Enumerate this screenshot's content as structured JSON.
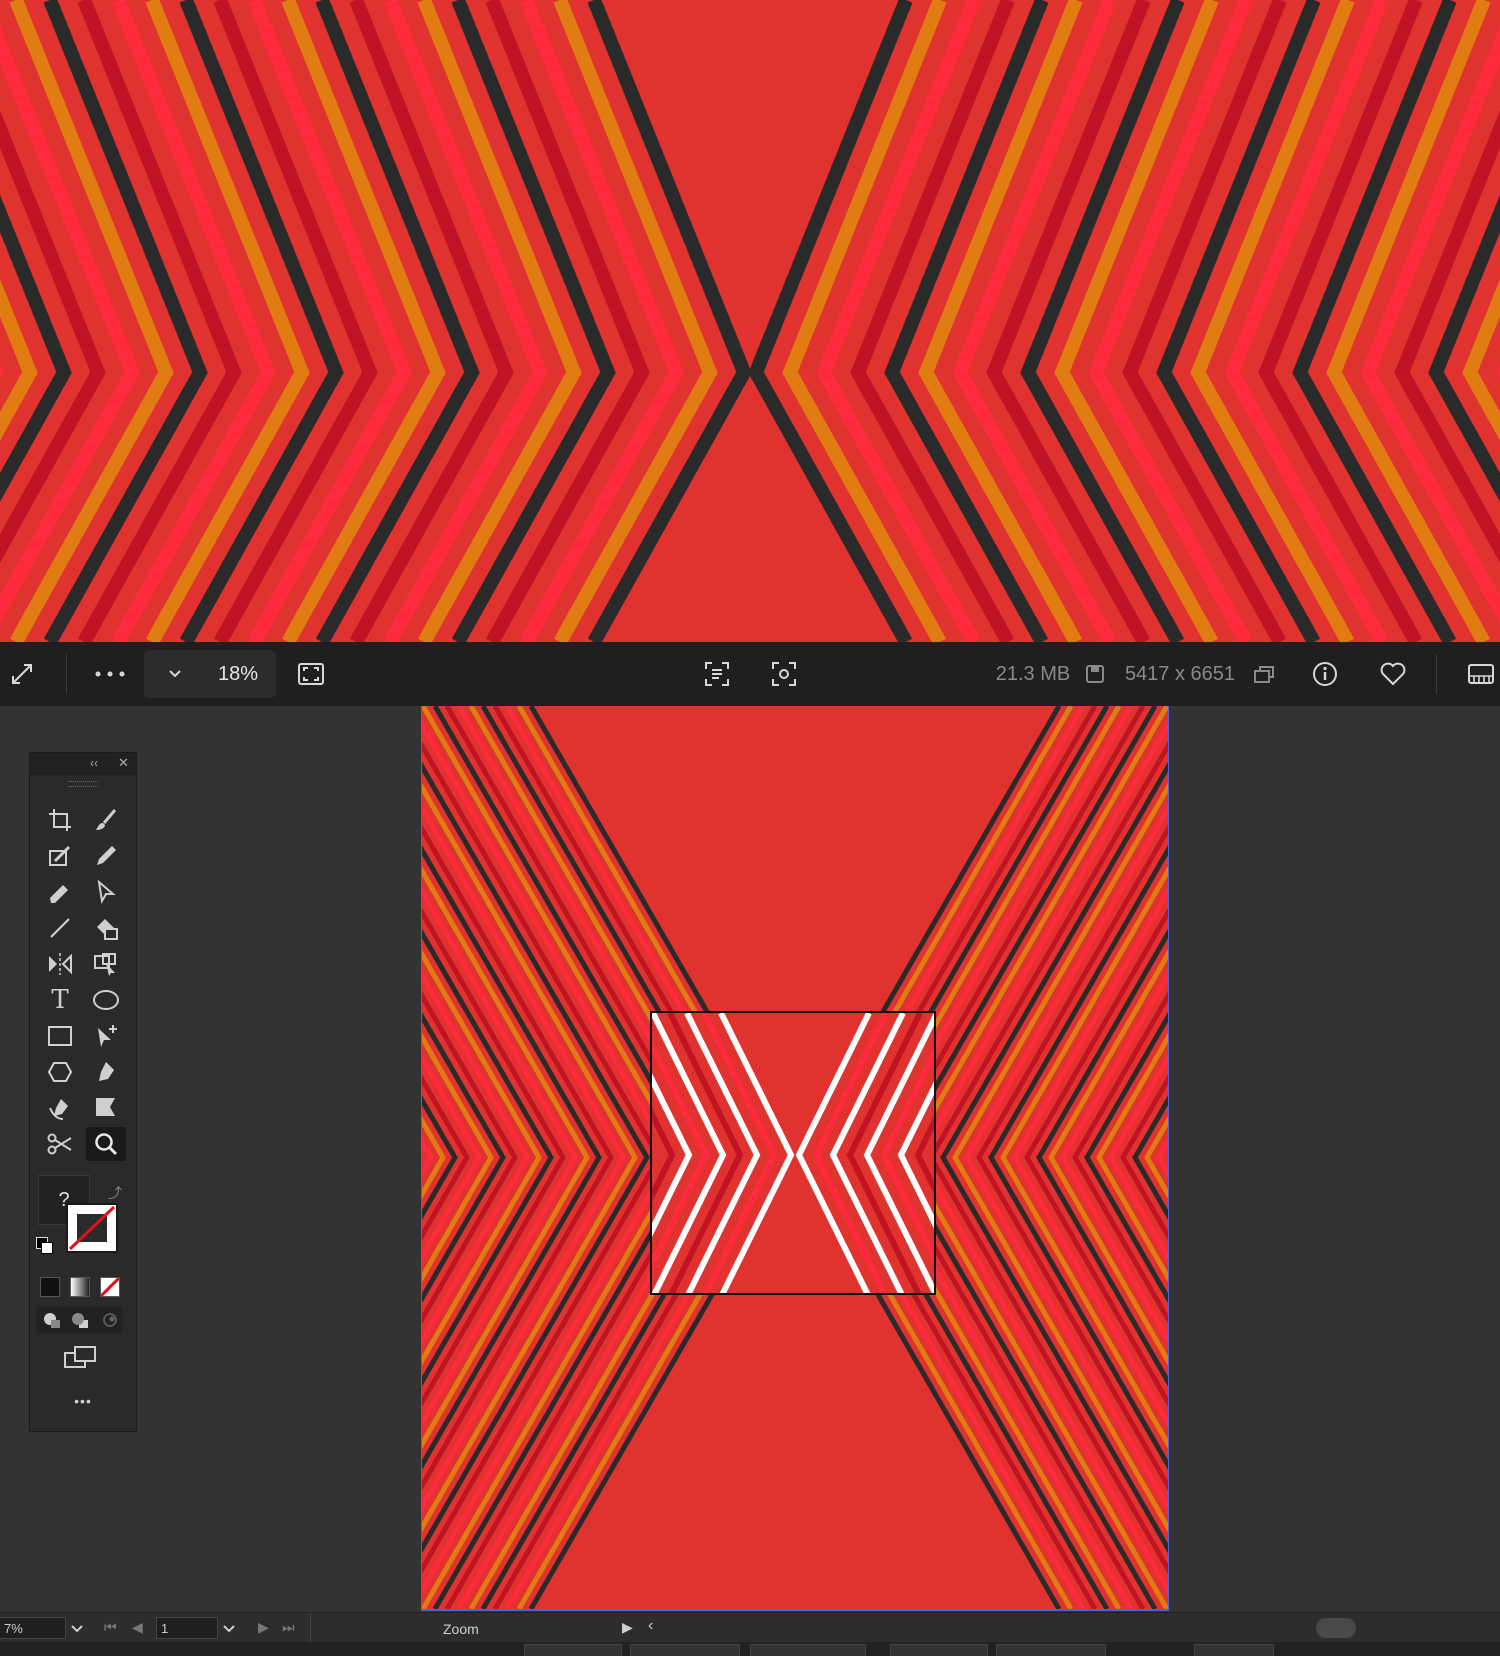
{
  "viewer": {
    "zoom": "18%",
    "file_size": "21.3 MB",
    "dimensions": "5417 x 6651",
    "icons": [
      "expand-icon",
      "more-icon",
      "chevron-down-icon",
      "fit-screen-icon",
      "ocr-text-icon",
      "visual-search-icon",
      "save-icon",
      "copy-icon",
      "info-icon",
      "heart-icon",
      "filmstrip-icon"
    ]
  },
  "toolbox": {
    "fill_stroke_label": "?",
    "more_label": "•••"
  },
  "statusbar": {
    "zoom_value": "7%",
    "artboard_number": "1",
    "tool_name": "Zoom"
  },
  "colors": {
    "red": "#e0322e",
    "bright_red": "#ff2a3c",
    "orange": "#e07c12",
    "dark": "#2a2a2a",
    "workspace": "#333333",
    "viewer_bar": "#1f1f1f"
  }
}
